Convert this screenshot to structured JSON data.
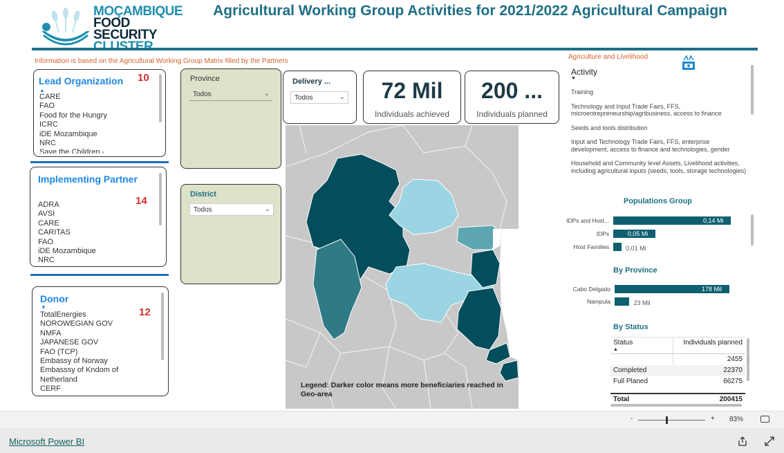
{
  "header": {
    "logo_line1": "MOÇAMBIQUE",
    "logo_line2": "FOOD SECURITY",
    "logo_line3": "CLUSTER",
    "title": "Agricultural Working Group Activities for 2021/2022 Agricultural Campaign",
    "info_note": "Information is based on the Agricultural Working Group Matrix filled by the Partners",
    "agri_note": "Agriculture and Livelihood"
  },
  "lead_org": {
    "title": "Lead Organization",
    "count": "10",
    "items": [
      "CARE",
      "FAO",
      "Food for the Hungry",
      "ICRC",
      "iDE Mozambique",
      "NRC",
      "Save the Children -"
    ]
  },
  "impl_partner": {
    "title": "Implementing Partner",
    "count": "14",
    "items": [
      "ADRA",
      "AVSI",
      "CARE",
      "CARITAS",
      "FAO",
      "iDE Mozambique",
      "NRC"
    ]
  },
  "donor": {
    "title": "Donor",
    "count": "12",
    "items": [
      "TotalEnergies",
      "NOROWEGIAN GOV",
      "NMFA",
      "JAPANESE GOV",
      "FAO (TCP)",
      "Embassy of Norway",
      "Embasssy of Kndom of",
      "Netherland",
      "CERF"
    ]
  },
  "filters": {
    "province_label": "Province",
    "province_value": "Todos",
    "district_label": "District",
    "district_value": "Todos",
    "delivery_label": "Delivery ...",
    "delivery_value": "Todos"
  },
  "kpis": {
    "achieved_value": "72 Mil",
    "achieved_label": "Individuals achieved",
    "planned_value": "200 ...",
    "planned_label": "Individuals planned"
  },
  "map": {
    "legend": "Legend: Darker color means more beneficiaries reached in Geo-area",
    "colors": {
      "dark": "#034e5c",
      "mid": "#2f7a85",
      "light": "#9bd4e3",
      "medium_light": "#5ea6b3",
      "base": "#c8c8c8"
    }
  },
  "activity": {
    "title": "Activity",
    "items": [
      "Training",
      "Technology and Input Trade Fairs, FFS, microentrepreneurship/agribusiness, access to finance",
      "Seeds and tools distribution",
      "Input and Technology Trade Fairs, FFS, enterprise development, access to finance and technologies, gender",
      "Household and Community level Assets, Livelihood activities, including agricultural inputs (seeds, tools, storage technologies)"
    ]
  },
  "populations": {
    "title": "Populations Group",
    "rows": [
      {
        "label": "IDPs and Host...",
        "value_label": "0,14 Mi",
        "value": 0.14
      },
      {
        "label": "IDPs",
        "value_label": "0,05 Mi",
        "value": 0.05
      },
      {
        "label": "Host Families",
        "value_label": "0,01 Mi",
        "value": 0.01
      }
    ]
  },
  "by_province": {
    "title": "By Province",
    "rows": [
      {
        "label": "Cabo Delgado",
        "value_label": "178 Mil",
        "value": 178
      },
      {
        "label": "Nampula",
        "value_label": "23 Mil",
        "value": 23
      }
    ]
  },
  "by_status": {
    "title": "By Status",
    "col1": "Status",
    "col2": "Individuals planned",
    "rows": [
      {
        "status": "",
        "planned": "2455"
      },
      {
        "status": "Completed",
        "planned": "22370"
      },
      {
        "status": "Full Planed",
        "planned": "66275"
      }
    ],
    "total_label": "Total",
    "total_value": "200415"
  },
  "footer": {
    "zoom_minus": "-",
    "zoom_plus": "+",
    "zoom_value": "83%",
    "zoom_level": 0.41,
    "powerbi_link": "Microsoft Power BI"
  }
}
